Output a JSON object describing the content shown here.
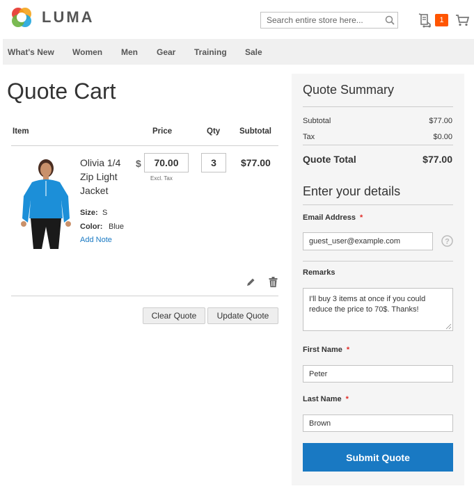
{
  "header": {
    "logo_text": "LUMA",
    "search_placeholder": "Search entire store here...",
    "quote_count": "1"
  },
  "nav": {
    "items": [
      "What's New",
      "Women",
      "Men",
      "Gear",
      "Training",
      "Sale"
    ]
  },
  "cart": {
    "title": "Quote Cart",
    "columns": {
      "item": "Item",
      "price": "Price",
      "qty": "Qty",
      "subtotal": "Subtotal"
    },
    "row": {
      "product_name": "Olivia 1/4 Zip Light Jacket",
      "options": [
        {
          "label": "Size:",
          "value": "S"
        },
        {
          "label": "Color:",
          "value": "Blue"
        }
      ],
      "add_note": "Add Note",
      "currency_symbol": "$",
      "price": "70.00",
      "excl_tax": "Excl. Tax",
      "qty": "3",
      "subtotal": "$77.00"
    },
    "clear_label": "Clear Quote",
    "update_label": "Update Quote"
  },
  "summary": {
    "title": "Quote Summary",
    "subtotal_label": "Subtotal",
    "subtotal_value": "$77.00",
    "tax_label": "Tax",
    "tax_value": "$0.00",
    "total_label": "Quote Total",
    "total_value": "$77.00"
  },
  "details": {
    "title": "Enter your details",
    "email_label": "Email Address",
    "email_value": "guest_user@example.com",
    "remarks_label": "Remarks",
    "remarks_value": "I'll buy 3 items at once if you could reduce the price to 70$. Thanks!",
    "first_name_label": "First Name",
    "first_name_value": "Peter",
    "last_name_label": "Last Name",
    "last_name_value": "Brown",
    "required_mark": "*",
    "submit_label": "Submit Quote"
  },
  "colors": {
    "accent": "#1979c3",
    "badge": "#ff5501",
    "required": "#e02b27"
  }
}
